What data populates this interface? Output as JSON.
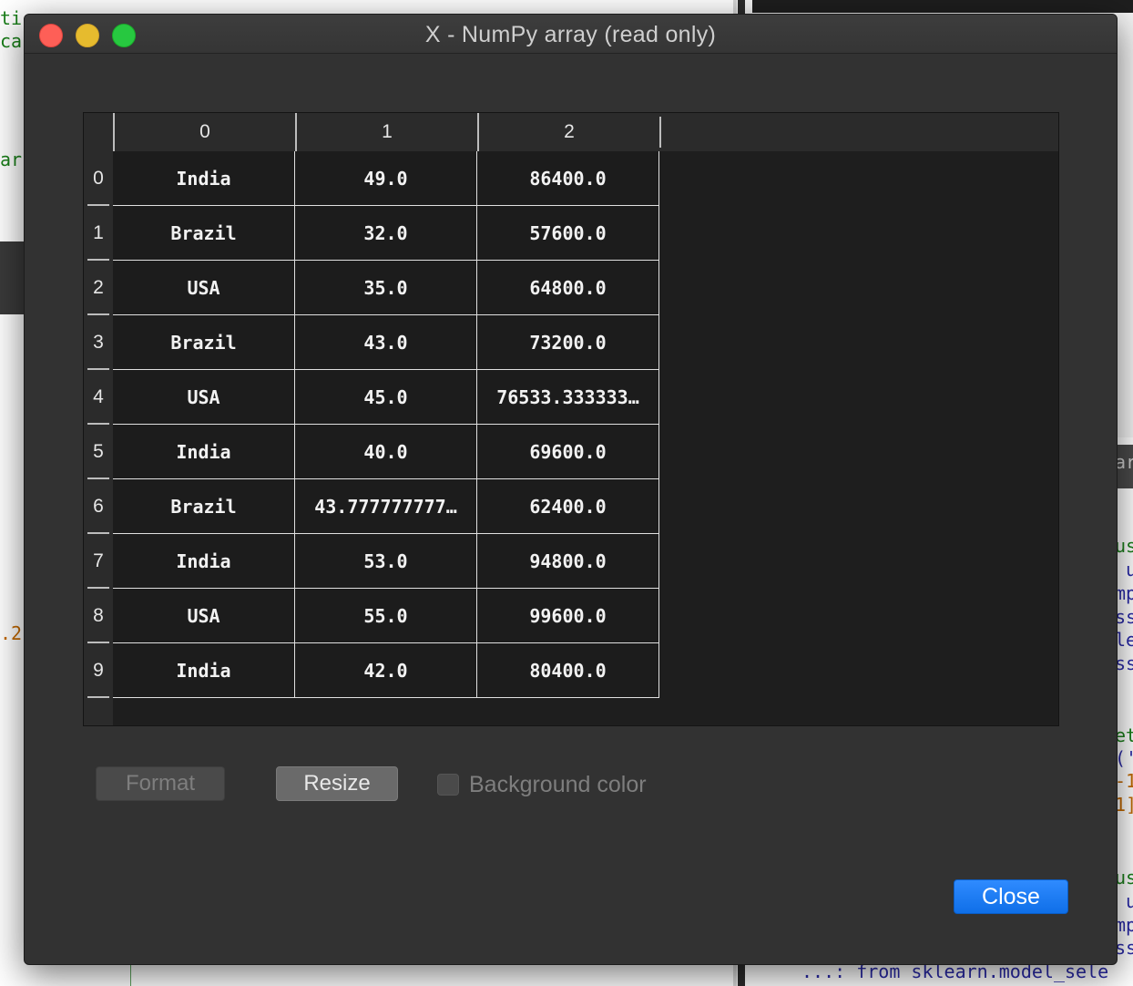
{
  "background": {
    "left_code": [
      "ti",
      "ca",
      "ar",
      ".2"
    ],
    "right_code": [
      "ar",
      "us",
      " u",
      "mp",
      "ss",
      "le",
      "ss",
      "et",
      "('",
      "-1",
      "1]",
      "us",
      " u",
      "mp",
      "ss"
    ],
    "bottom_code": "...: from sklearn.model_sele"
  },
  "window": {
    "title": "X - NumPy array (read only)"
  },
  "table": {
    "columns": [
      "0",
      "1",
      "2"
    ],
    "row_labels": [
      "0",
      "1",
      "2",
      "3",
      "4",
      "5",
      "6",
      "7",
      "8",
      "9"
    ],
    "rows": [
      [
        "India",
        "49.0",
        "86400.0"
      ],
      [
        "Brazil",
        "32.0",
        "57600.0"
      ],
      [
        "USA",
        "35.0",
        "64800.0"
      ],
      [
        "Brazil",
        "43.0",
        "73200.0"
      ],
      [
        "USA",
        "45.0",
        "76533.333333…"
      ],
      [
        "India",
        "40.0",
        "69600.0"
      ],
      [
        "Brazil",
        "43.777777777…",
        "62400.0"
      ],
      [
        "India",
        "53.0",
        "94800.0"
      ],
      [
        "USA",
        "55.0",
        "99600.0"
      ],
      [
        "India",
        "42.0",
        "80400.0"
      ]
    ]
  },
  "controls": {
    "format_label": "Format",
    "resize_label": "Resize",
    "background_color_label": "Background color",
    "background_color_checked": false,
    "close_label": "Close"
  },
  "colors": {
    "accent": "#0f6fe8",
    "window_bg": "#323232",
    "cell_bg": "#1c1c1c"
  }
}
